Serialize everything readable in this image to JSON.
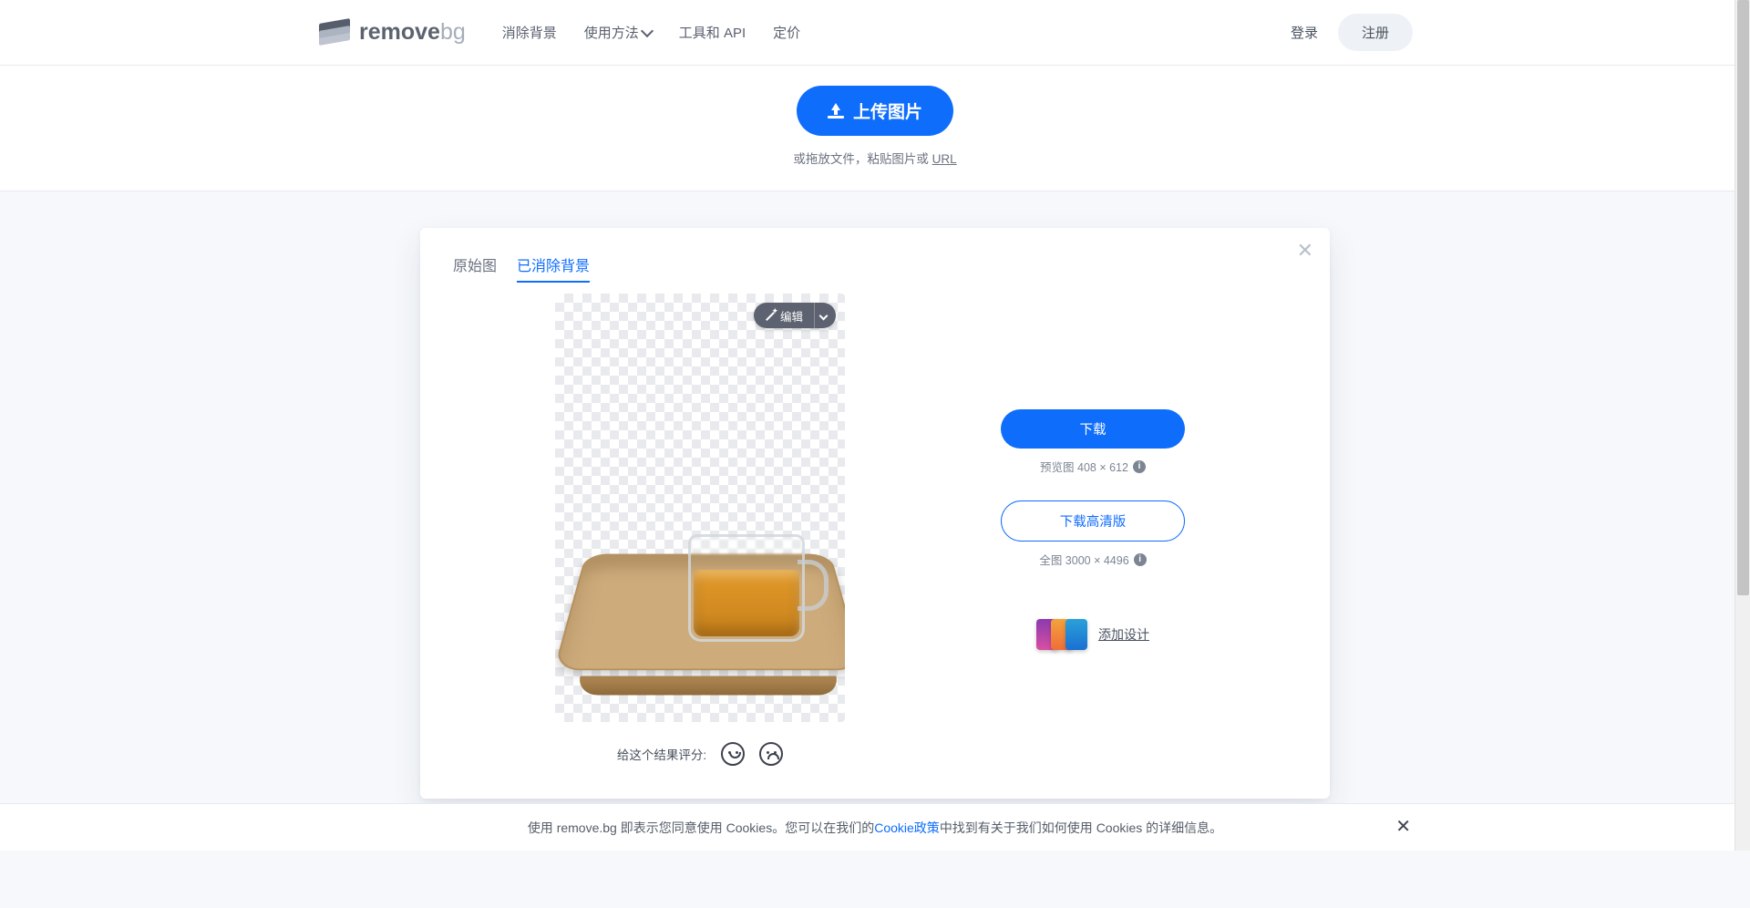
{
  "brand": {
    "name": "remove",
    "suffix": "bg"
  },
  "nav": {
    "removeBg": "消除背景",
    "howTo": "使用方法",
    "tools": "工具和 API",
    "pricing": "定价"
  },
  "auth": {
    "login": "登录",
    "signup": "注册"
  },
  "upload": {
    "button": "上传图片",
    "subPrefix": "或拖放文件，粘贴图片或 ",
    "urlLink": "URL"
  },
  "card": {
    "tabs": {
      "original": "原始图",
      "removed": "已消除背景"
    },
    "editLabel": "编辑",
    "ratingPrompt": "给这个结果评分:",
    "actions": {
      "download": "下载",
      "previewLabel": "预览图 408 × 612",
      "downloadHd": "下载高清版",
      "fullLabel": "全图 3000 × 4496",
      "addDesign": "添加设计"
    }
  },
  "cookie": {
    "pre": "使用 remove.bg 即表示您同意使用 Cookies。您可以在我们的",
    "link": "Cookie政策",
    "post": "中找到有关于我们如何使用 Cookies 的详细信息。"
  }
}
